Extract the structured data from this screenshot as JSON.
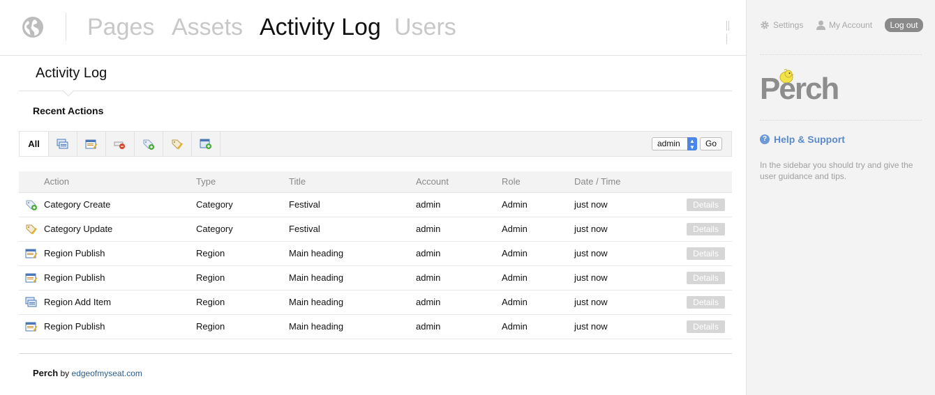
{
  "nav": {
    "items": [
      {
        "label": "Pages",
        "active": false
      },
      {
        "label": "Assets",
        "active": false
      },
      {
        "label": "Activity Log",
        "active": true
      },
      {
        "label": "Users",
        "active": false
      }
    ]
  },
  "sidebar": {
    "settings_label": "Settings",
    "account_label": "My Account",
    "logout_label": "Log out",
    "logo_text": "Perch",
    "help_title": "Help & Support",
    "help_text": "In the sidebar you should try and give the user guidance and tips."
  },
  "main": {
    "page_title": "Activity Log",
    "section_title": "Recent Actions",
    "filter": {
      "all_label": "All",
      "tab_icons": [
        "region-add-item-icon",
        "region-publish-icon",
        "region-delete-icon",
        "category-create-icon",
        "category-update-icon",
        "page-create-icon"
      ],
      "role_value": "admin",
      "go_label": "Go"
    },
    "table": {
      "columns": [
        "Action",
        "Type",
        "Title",
        "Account",
        "Role",
        "Date / Time"
      ],
      "details_label": "Details",
      "rows": [
        {
          "icon": "category-create-icon",
          "action": "Category Create",
          "type": "Category",
          "title": "Festival",
          "account": "admin",
          "role": "Admin",
          "date": "just now"
        },
        {
          "icon": "category-update-icon",
          "action": "Category Update",
          "type": "Category",
          "title": "Festival",
          "account": "admin",
          "role": "Admin",
          "date": "just now"
        },
        {
          "icon": "region-publish-icon",
          "action": "Region Publish",
          "type": "Region",
          "title": "Main heading",
          "account": "admin",
          "role": "Admin",
          "date": "just now"
        },
        {
          "icon": "region-publish-icon",
          "action": "Region Publish",
          "type": "Region",
          "title": "Main heading",
          "account": "admin",
          "role": "Admin",
          "date": "just now"
        },
        {
          "icon": "region-add-item-icon",
          "action": "Region Add Item",
          "type": "Region",
          "title": "Main heading",
          "account": "admin",
          "role": "Admin",
          "date": "just now"
        },
        {
          "icon": "region-publish-icon",
          "action": "Region Publish",
          "type": "Region",
          "title": "Main heading",
          "account": "admin",
          "role": "Admin",
          "date": "just now"
        }
      ]
    }
  },
  "footer": {
    "brand": "Perch",
    "by": "by",
    "link_text": "edgeofmyseat.com"
  },
  "colors": {
    "accent_blue": "#5b8ac9",
    "select_blue": "#4a86e8",
    "logout_bg": "#8a8a8a",
    "details_bg": "#d6d6d6",
    "logo_bird": "#f2e34a"
  }
}
